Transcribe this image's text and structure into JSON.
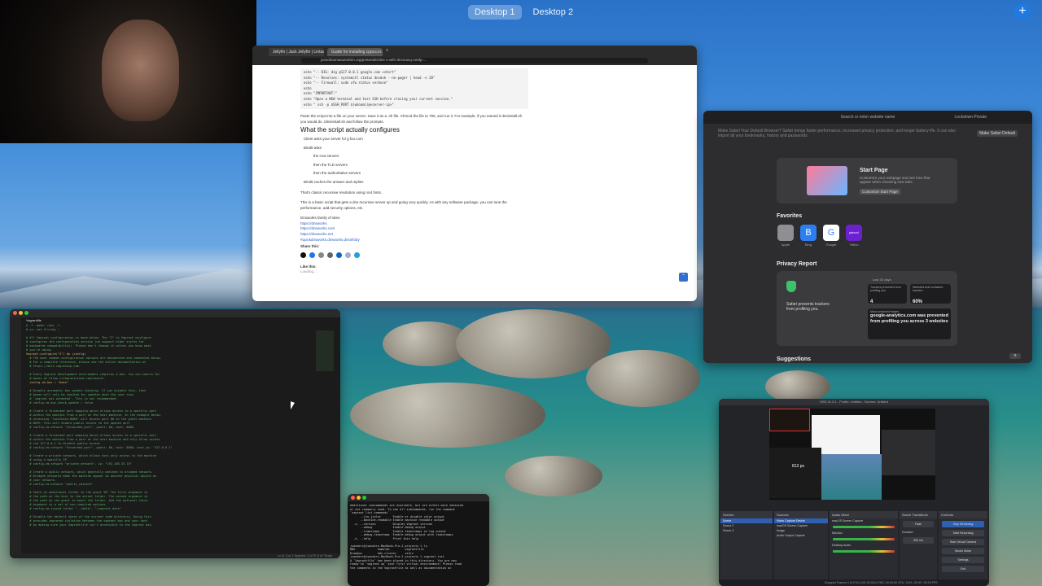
{
  "spaces": {
    "desktop1": "Desktop 1",
    "desktop2": "Desktop 2"
  },
  "browser": {
    "tabs": [
      "Jellyfin | Jack Jellyfin | Lintas El...",
      "Guide for installing cppcs.in.32",
      "+"
    ],
    "url": "jonsdinarmasutrahim.org/pretender/dns-o-with-dnsmasq-rotelp-...",
    "code_lines": [
      "echo \"-- DIG: dig @127.0.0.1 google.com +short\"",
      "echo \"-- Resolves: systemctl status dnsmsk --no-pager | head -n 20\"",
      "echo \"-- Firewall: sudo ufw status verbose\"",
      "echo",
      "echo \"IMPORTANT:\"",
      "echo \"Open a NEW terminal and test SSH before closing your current session.\"",
      "echo \"  ssh -p $SSH_PORT $(whoami)@<server-ip>\""
    ],
    "intro": "Paste the script into a file on your server. Save it as a .sh file. Chmod the file to 755, and run it. For example, if you named it dnsinstall.sh you would do ./dnsinstall.sh and follow the prompts.",
    "heading": "What the script actually configures",
    "bullets": [
      "Client asks your server for jj.foo.com",
      "Bind9 asks",
      "the root servers",
      "then the TLD servers",
      "then the authoritative servers",
      "Bind9 caches the answer and replies"
    ],
    "p1": "That's classic recursive resolution using root hints.",
    "p2": "This is a basic script that gets a dns recursive server up and going very quickly. As with any software package, you can tune the performance, add security options, etc.",
    "links_title": "Dnsworks family of sites",
    "links": [
      "https://dnsworks",
      "https://dnsworks.com",
      "https://dnsworks.net",
      "#quickdnsworks.dnsworks.dnsinfoby"
    ],
    "share": "Share this:",
    "like": "Like this:",
    "loading": "Loading..."
  },
  "safari": {
    "address": "Search or enter website name",
    "lockdown": "Lockdown Private",
    "note": "Make Safari Your Default Browser? Safari brings faster performance, increased privacy protection, and longer battery life. It can also import all your bookmarks, history and passwords",
    "default_btn": "Make Safari Default",
    "start_title": "Start Page",
    "start_sub": "Customize your webpage and see how that appear when choosing new tabs.",
    "start_btn": "Customize Start Page",
    "favorites_title": "Favorites",
    "favorites": [
      {
        "name": "Apple",
        "glyph": "",
        "color": "#8e8e93"
      },
      {
        "name": "Bing",
        "glyph": "B",
        "color": "#2b7ff0"
      },
      {
        "name": "Google",
        "glyph": "G",
        "color": "#ffffff"
      },
      {
        "name": "Yahoo",
        "glyph": "yahoo!",
        "color": "#6d1fd2"
      }
    ],
    "privacy_title": "Privacy Report",
    "privacy_last": "Last 30 days",
    "privacy_text": "Safari prevents trackers from profiling you.",
    "trackers_label": "Trackers prevented from profiling you",
    "trackers_value": "4",
    "websites_label": "Websites that contacted trackers",
    "websites_value": "60%",
    "most_label": "Most contacted tracker",
    "most_value": "google-analytics.com was prevented from profiling you across 3 websites",
    "suggestions_title": "Suggestions"
  },
  "term": {
    "title": "Vagrantfile",
    "lines": [
      "# -*- mode: ruby -*-",
      "# vi: set ft=ruby :",
      "",
      "# All Vagrant configuration is done below. The \"2\" in Vagrant.configure",
      "# configures the configuration version (we support older styles for",
      "# backwards compatibility). Please don't change it unless you know what",
      "# you're doing.",
      "Vagrant.configure(\"2\") do |config|",
      "  # The most common configuration options are documented and commented below.",
      "  # For a complete reference, please see the online documentation at",
      "  # https://docs.vagrantup.com.",
      "",
      "  # Every Vagrant development environment requires a box. You can search for",
      "  # boxes at https://vagrantcloud.com/search.",
      "  config.vm.box = \"base\"",
      "",
      "  # Disable automatic box update checking. If you disable this, then",
      "  # boxes will only be checked for updates when the user runs",
      "  # `vagrant box outdated`. This is not recommended.",
      "  # config.vm.box_check_update = false",
      "",
      "  # Create a forwarded port mapping which allows access to a specific port",
      "  # within the machine from a port on the host machine. In the example below,",
      "  # accessing \"localhost:8080\" will access port 80 on the guest machine.",
      "  # NOTE: This will enable public access to the opened port",
      "  # config.vm.network \"forwarded_port\", guest: 80, host: 8080",
      "",
      "  # Create a forwarded port mapping which allows access to a specific port",
      "  # within the machine from a port on the host machine and only allow access",
      "  # via 127.0.0.1 to disable public access",
      "  # config.vm.network \"forwarded_port\", guest: 80, host: 8080, host_ip: \"127.0.0.1\"",
      "",
      "  # Create a private network, which allows host-only access to the machine",
      "  # using a specific IP.",
      "  # config.vm.network \"private_network\", ip: \"192.168.33.10\"",
      "",
      "  # Create a public network, which generally matched to bridged network.",
      "  # Bridged networks make the machine appear as another physical device on",
      "  # your network.",
      "  # config.vm.network \"public_network\"",
      "",
      "  # Share an additional folder to the guest VM. The first argument is",
      "  # the path on the host to the actual folder. The second argument is",
      "  # the path on the guest to mount the folder. And the optional third",
      "  # argument is a set of non-required options.",
      "  # config.vm.synced_folder \"../data\", \"/vagrant_data\"",
      "",
      "  # Disable the default share of the current code directory. Doing this",
      "  # provides improved isolation between the vagrant box and your host",
      "  # by making sure your Vagrantfile isn't accessible to the vagrant box."
    ],
    "status": "Ln 8, Col 1   Spaces: 2   UTF-8   LF   Ruby"
  },
  "sterm": {
    "lines": [
      "Additional subcommands are available, but are either more advanced",
      "or not commonly used. To see all subcommands, run the command",
      "`vagrant list-commands`.",
      "      --[no-]color       Enable or disable color output",
      "      --machine-readable Enable machine readable output",
      "  -v, --version          Display Vagrant version",
      "      --debug            Enable debug output",
      "      --timestamp        Enable timestamps on log output",
      "      --debug-timestamp  Enable debug output with timestamps",
      "  -h, --help             Print this help",
      "",
      "jsanders@jsanders-MacBook-Pro-2 projects % ls",
      "DNS             homelab         vagrantfile",
      "Dropbox         k8s-cluster     zshrc",
      "jsanders@jsanders-MacBook-Pro-2 projects % vagrant init",
      "A `Vagrantfile` has been placed in this directory. You are now",
      "ready to `vagrant up` your first virtual environment! Please read",
      "the comments in the Vagrantfile as well as documentation on"
    ]
  },
  "obs": {
    "title": "OBS 31.0.1 - Profile: Untitled - Scenes: Untitled",
    "preview_label": "813 px",
    "scenes_title": "Scenes",
    "scenes": [
      "Scene",
      "Scene 2",
      "Scene 3"
    ],
    "sources_title": "Sources",
    "sources": [
      "Video Capture Device",
      "macOS Screen Capture",
      "Image",
      "Audio Output Capture"
    ],
    "mixer_title": "Audio Mixer",
    "mixer": [
      "macOS Screen Capture",
      "Mic/Aux",
      "Desktop Audio"
    ],
    "transitions_title": "Scene Transitions",
    "transition": "Fade",
    "duration_label": "Duration",
    "duration": "300 ms",
    "controls_title": "Controls",
    "controls": [
      "Stop Streaming",
      "Start Recording",
      "Start Virtual Camera",
      "Studio Mode",
      "Settings",
      "Exit"
    ],
    "status": "Dropped Frames 0 (0.0%)   LIVE 00:05:01   REC 00:00:00   CPU: 3.8%, 30.00 / 30.00 FPS"
  }
}
